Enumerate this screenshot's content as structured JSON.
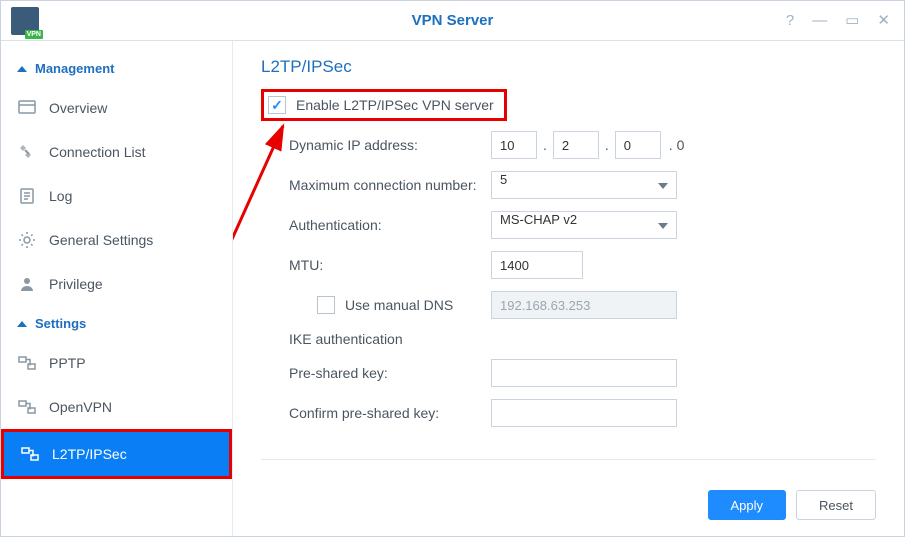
{
  "window": {
    "title": "VPN Server"
  },
  "sidebar": {
    "sections": {
      "management": {
        "label": "Management"
      },
      "settings": {
        "label": "Settings"
      }
    },
    "items": {
      "overview": "Overview",
      "connection_list": "Connection List",
      "log": "Log",
      "general_settings": "General Settings",
      "privilege": "Privilege",
      "pptp": "PPTP",
      "openvpn": "OpenVPN",
      "l2tp": "L2TP/IPSec"
    }
  },
  "panel": {
    "title": "L2TP/IPSec",
    "enable_label": "Enable L2TP/IPSec VPN server",
    "enable_checked": true,
    "fields": {
      "dyn_ip_label": "Dynamic IP address:",
      "dyn_ip": {
        "o1": "10",
        "o2": "2",
        "o3": "0",
        "o4": "0"
      },
      "max_conn_label": "Maximum connection number:",
      "max_conn_value": "5",
      "auth_label": "Authentication:",
      "auth_value": "MS-CHAP v2",
      "mtu_label": "MTU:",
      "mtu_value": "1400",
      "manual_dns_label": "Use manual DNS",
      "manual_dns_value": "192.168.63.253",
      "ike_label": "IKE authentication",
      "psk_label": "Pre-shared key:",
      "confirm_psk_label": "Confirm pre-shared key:"
    }
  },
  "buttons": {
    "apply": "Apply",
    "reset": "Reset"
  }
}
